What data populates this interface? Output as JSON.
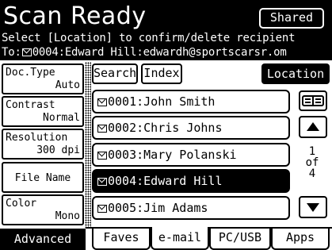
{
  "header": {
    "title": "Scan Ready",
    "shared_label": "Shared",
    "instruction": "Select [Location] to confirm/delete recipient",
    "to_prefix": "To:",
    "to_value": "0004:Edward Hill:edwardh@sportscarsr.om"
  },
  "settings": [
    {
      "label": "Doc.Type",
      "value": "Auto"
    },
    {
      "label": "Contrast",
      "value": "Normal"
    },
    {
      "label": "Resolution",
      "value": "300 dpi"
    },
    {
      "label": "File Name",
      "value": ""
    },
    {
      "label": "Color",
      "value": "Mono"
    }
  ],
  "search_label": "Search",
  "index_label": "Index",
  "location_label": "Location",
  "recipients": [
    {
      "text": "0001:John Smith",
      "selected": false
    },
    {
      "text": "0002:Chris Johns",
      "selected": false
    },
    {
      "text": "0003:Mary Polanski",
      "selected": false
    },
    {
      "text": "0004:Edward Hill",
      "selected": true
    },
    {
      "text": "0005:Jim Adams",
      "selected": false
    }
  ],
  "pager": {
    "current": "1",
    "of_label": "of",
    "total": "4"
  },
  "icons": {
    "view_toggle": "list-view-icon",
    "up": "up-arrow-icon",
    "down": "down-arrow-icon",
    "recipient": "envelope-icon"
  },
  "advanced_label": "Advanced",
  "tabs": [
    {
      "label": "Faves",
      "active": false
    },
    {
      "label": "e-mail",
      "active": true
    },
    {
      "label": "PC/USB",
      "active": false
    },
    {
      "label": "Apps",
      "active": false
    }
  ]
}
